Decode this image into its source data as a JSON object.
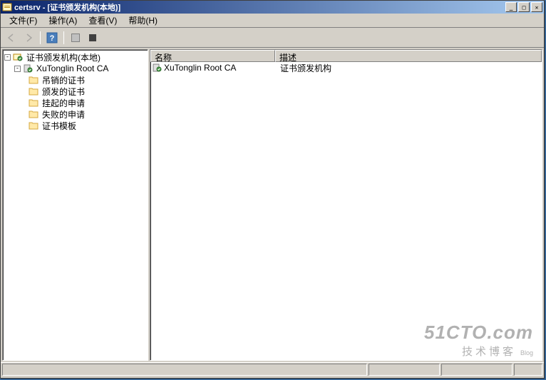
{
  "titlebar": {
    "app": "certsrv",
    "doc": "[证书颁发机构(本地)]"
  },
  "menubar": {
    "file": "文件(F)",
    "action": "操作(A)",
    "view": "查看(V)",
    "help": "帮助(H)"
  },
  "toolbar": {
    "back": "←",
    "forward": "→",
    "help": "?",
    "export1": "▦",
    "export2": "■"
  },
  "tree": {
    "root": "证书颁发机构(本地)",
    "ca": "XuTonglin Root CA",
    "children": [
      "吊销的证书",
      "颁发的证书",
      "挂起的申请",
      "失败的申请",
      "证书模板"
    ]
  },
  "list": {
    "headers": {
      "name": "名称",
      "desc": "描述"
    },
    "rows": [
      {
        "name": "XuTonglin Root CA",
        "desc": "证书颁发机构"
      }
    ]
  },
  "watermark": {
    "line1": "51CTO.com",
    "line2": "技术博客",
    "line3": "Blog"
  }
}
